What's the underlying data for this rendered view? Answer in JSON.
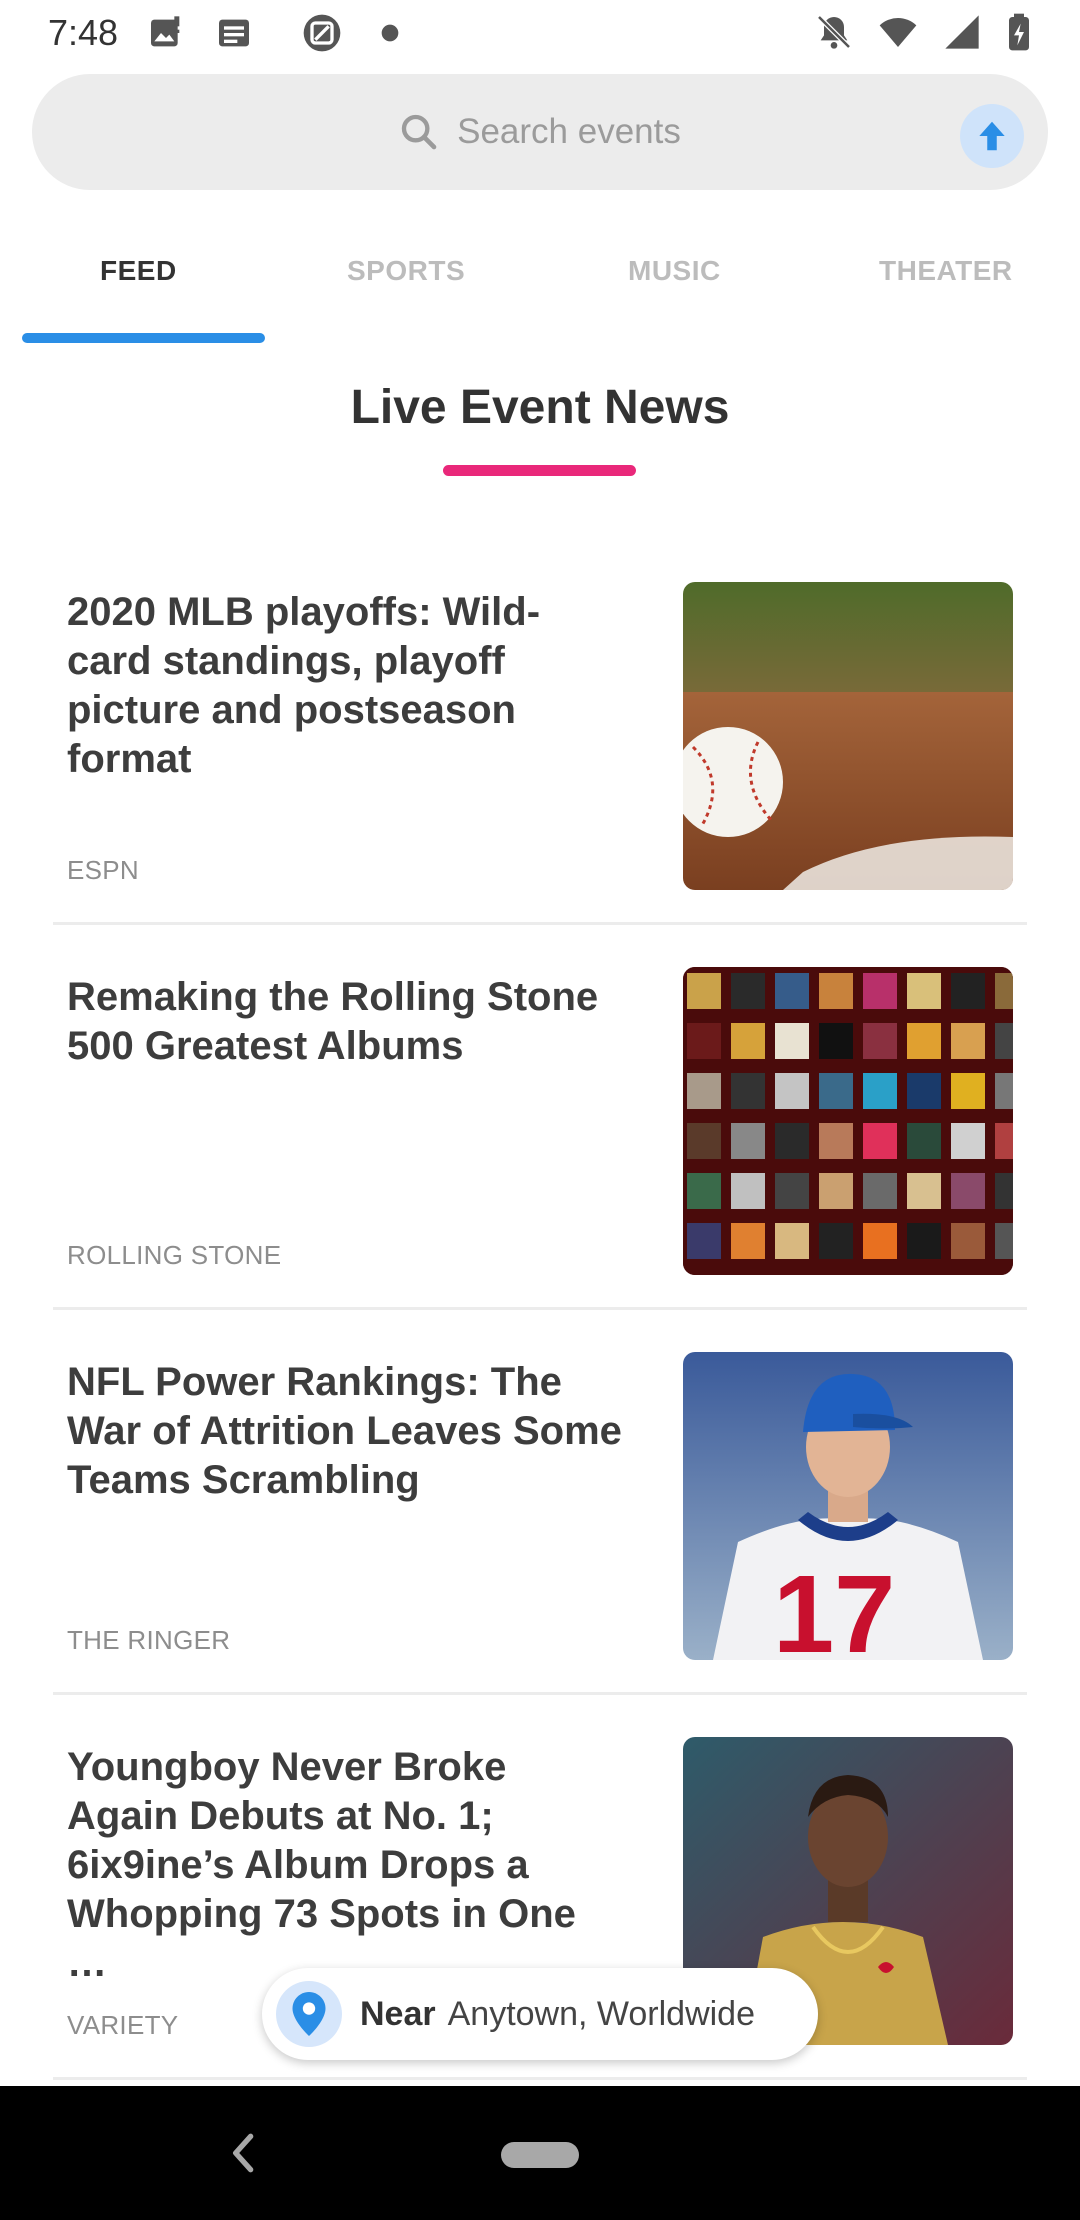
{
  "status_bar": {
    "time": "7:48",
    "icons_left": [
      "image-icon",
      "message-icon",
      "screenshot-app-icon",
      "dot-icon"
    ],
    "icons_right": [
      "bell-off-icon",
      "wifi-icon",
      "cell-signal-icon",
      "battery-icon"
    ]
  },
  "search": {
    "placeholder": "Search events",
    "icon": "search-icon",
    "upload_icon": "arrow-up-icon",
    "accent": "#2a8ee6"
  },
  "tabs": [
    {
      "label": "FEED",
      "active": true
    },
    {
      "label": "SPORTS",
      "active": false
    },
    {
      "label": "MUSIC",
      "active": false
    },
    {
      "label": "THEATER",
      "active": false
    }
  ],
  "section": {
    "title": "Live Event News",
    "underline_color": "#e9287a"
  },
  "feed": [
    {
      "title": "2020 MLB playoffs: Wild-card standings, playoff picture and postseason format",
      "source": "ESPN",
      "thumb": "baseball-on-dirt"
    },
    {
      "title": "Remaking the Rolling Stone 500 Greatest Albums",
      "source": "ROLLING STONE",
      "thumb": "album-cover-grid"
    },
    {
      "title": "NFL Power Rankings: The War of Attrition Leaves Some Teams Scrambling",
      "source": "THE RINGER",
      "thumb": "football-player"
    },
    {
      "title": "Youngboy Never Broke Again Debuts at No. 1; 6ix9ine’s Album Drops a Whopping 73 Spots in One …",
      "source": "VARIETY",
      "thumb": "rapper-portrait"
    }
  ],
  "location": {
    "prefix": "Near",
    "place": "Anytown, Worldwide",
    "icon": "location-pin-icon"
  },
  "nav": {
    "back_icon": "back-chevron-icon",
    "home_icon": "home-pill-icon"
  }
}
